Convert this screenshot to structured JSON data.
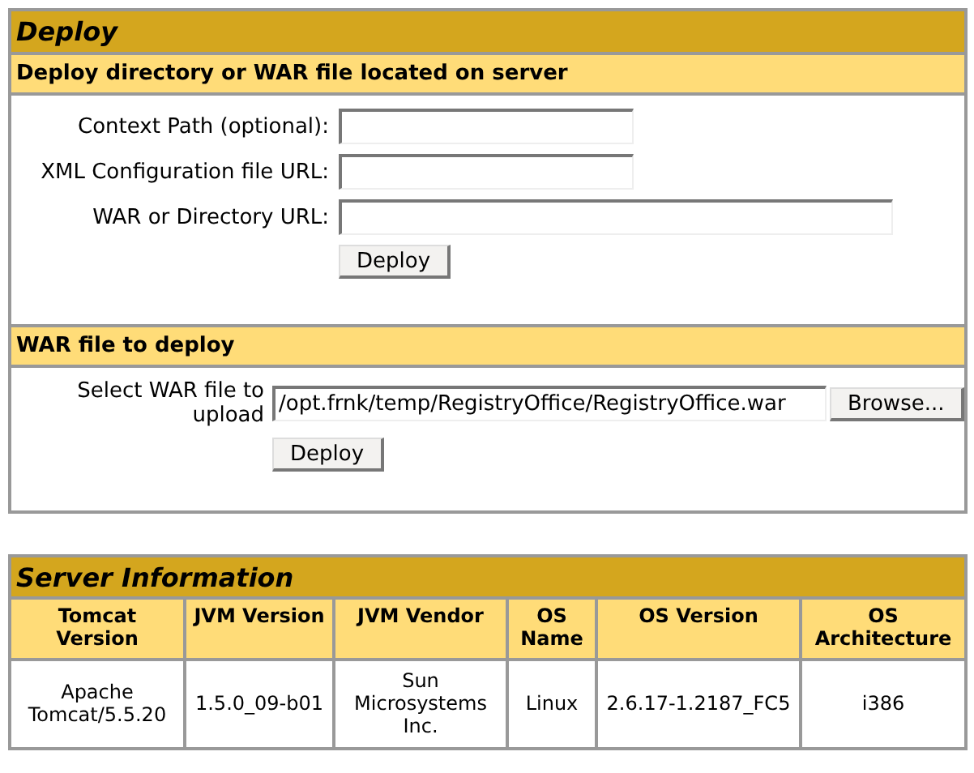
{
  "deploy": {
    "title": "Deploy",
    "server_section": {
      "title": "Deploy directory or WAR file located on server",
      "fields": [
        {
          "label": "Context Path (optional):",
          "kind": "short"
        },
        {
          "label": "XML Configuration file URL:",
          "kind": "short"
        },
        {
          "label": "WAR or Directory URL:",
          "kind": "long"
        }
      ],
      "button": "Deploy"
    },
    "upload_section": {
      "title": "WAR file to deploy",
      "label": "Select WAR file to upload",
      "value": "/opt.frnk/temp/RegistryOffice/RegistryOffice.war",
      "browse": "Browse...",
      "button": "Deploy"
    }
  },
  "server_info": {
    "title": "Server Information",
    "columns": [
      "Tomcat Version",
      "JVM Version",
      "JVM Vendor",
      "OS Name",
      "OS Version",
      "OS Architecture"
    ],
    "rows": [
      [
        "Apache Tomcat/5.5.20",
        "1.5.0_09-b01",
        "Sun Microsystems Inc.",
        "Linux",
        "2.6.17-1.2187_FC5",
        "i386"
      ]
    ]
  }
}
